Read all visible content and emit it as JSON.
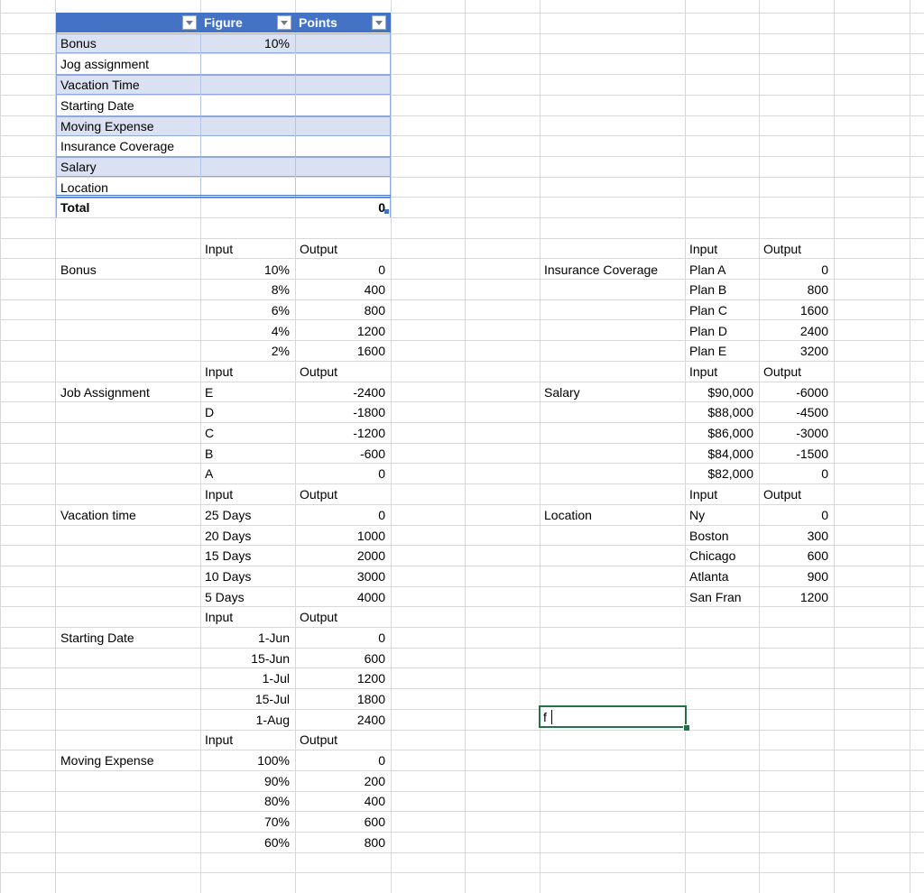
{
  "summary_table": {
    "headers": {
      "figure": "Figure",
      "points": "Points"
    },
    "rows": [
      {
        "label": "Bonus",
        "figure": "10%",
        "points": ""
      },
      {
        "label": "Jog assignment",
        "figure": "",
        "points": ""
      },
      {
        "label": "Vacation Time",
        "figure": "",
        "points": ""
      },
      {
        "label": "Starting Date",
        "figure": "",
        "points": ""
      },
      {
        "label": "Moving Expense",
        "figure": "",
        "points": ""
      },
      {
        "label": "Insurance Coverage",
        "figure": "",
        "points": ""
      },
      {
        "label": "Salary",
        "figure": "",
        "points": ""
      },
      {
        "label": "Location",
        "figure": "",
        "points": ""
      }
    ],
    "total": {
      "label": "Total",
      "points": "0"
    }
  },
  "left_lookups": [
    {
      "name": "Bonus",
      "input_header": "Input",
      "output_header": "Output",
      "rows": [
        {
          "input": "10%",
          "output": "0"
        },
        {
          "input": "8%",
          "output": "400"
        },
        {
          "input": "6%",
          "output": "800"
        },
        {
          "input": "4%",
          "output": "1200"
        },
        {
          "input": "2%",
          "output": "1600"
        }
      ]
    },
    {
      "name": "Job Assignment",
      "input_header": "Input",
      "output_header": "Output",
      "rows": [
        {
          "input": "E",
          "output": "-2400"
        },
        {
          "input": "D",
          "output": "-1800"
        },
        {
          "input": "C",
          "output": "-1200"
        },
        {
          "input": "B",
          "output": "-600"
        },
        {
          "input": "A",
          "output": "0"
        }
      ]
    },
    {
      "name": "Vacation time",
      "input_header": "Input",
      "output_header": "Output",
      "rows": [
        {
          "input": "25 Days",
          "output": "0"
        },
        {
          "input": "20 Days",
          "output": "1000"
        },
        {
          "input": "15 Days",
          "output": "2000"
        },
        {
          "input": "10 Days",
          "output": "3000"
        },
        {
          "input": "5 Days",
          "output": "4000"
        }
      ]
    },
    {
      "name": "Starting Date",
      "input_header": "Input",
      "output_header": "Output",
      "rows": [
        {
          "input": "1-Jun",
          "output": "0"
        },
        {
          "input": "15-Jun",
          "output": "600"
        },
        {
          "input": "1-Jul",
          "output": "1200"
        },
        {
          "input": "15-Jul",
          "output": "1800"
        },
        {
          "input": "1-Aug",
          "output": "2400"
        }
      ]
    },
    {
      "name": "Moving Expense",
      "input_header": "Input",
      "output_header": "Output",
      "rows": [
        {
          "input": "100%",
          "output": "0"
        },
        {
          "input": "90%",
          "output": "200"
        },
        {
          "input": "80%",
          "output": "400"
        },
        {
          "input": "70%",
          "output": "600"
        },
        {
          "input": "60%",
          "output": "800"
        }
      ]
    }
  ],
  "right_lookups": [
    {
      "name": "Insurance Coverage",
      "input_header": "Input",
      "output_header": "Output",
      "rows": [
        {
          "input": "Plan A",
          "output": "0"
        },
        {
          "input": "Plan B",
          "output": "800"
        },
        {
          "input": "Plan C",
          "output": "1600"
        },
        {
          "input": "Plan D",
          "output": "2400"
        },
        {
          "input": "Plan E",
          "output": "3200"
        }
      ]
    },
    {
      "name": "Salary",
      "input_header": "Input",
      "output_header": "Output",
      "rows": [
        {
          "input": "$90,000",
          "output": "-6000"
        },
        {
          "input": "$88,000",
          "output": "-4500"
        },
        {
          "input": "$86,000",
          "output": "-3000"
        },
        {
          "input": "$84,000",
          "output": "-1500"
        },
        {
          "input": "$82,000",
          "output": "0"
        }
      ]
    },
    {
      "name": "Location",
      "input_header": "Input",
      "output_header": "Output",
      "rows": [
        {
          "input": "Ny",
          "output": "0"
        },
        {
          "input": "Boston",
          "output": "300"
        },
        {
          "input": "Chicago",
          "output": "600"
        },
        {
          "input": "Atlanta",
          "output": "900"
        },
        {
          "input": "San Fran",
          "output": "1200"
        }
      ]
    }
  ],
  "active_cell": {
    "value": "f"
  },
  "colors": {
    "table_header": "#4472c4",
    "table_band": "#d9e1f2",
    "selection": "#217346",
    "gridline": "#d8d8d8"
  }
}
